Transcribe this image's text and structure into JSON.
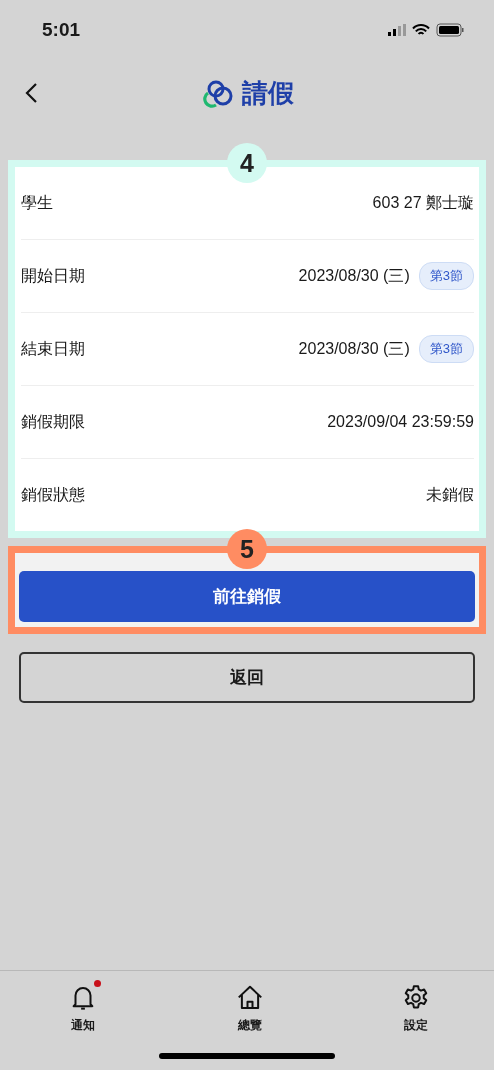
{
  "status_bar": {
    "time": "5:01"
  },
  "header": {
    "title": "請假"
  },
  "details": {
    "callout": "4",
    "rows": [
      {
        "label": "學生",
        "value": "603 27 鄭士璇"
      },
      {
        "label": "開始日期",
        "value": "2023/08/30 (三)",
        "tag": "第3節"
      },
      {
        "label": "結束日期",
        "value": "2023/08/30 (三)",
        "tag": "第3節"
      },
      {
        "label": "銷假期限",
        "value": "2023/09/04 23:59:59"
      },
      {
        "label": "銷假狀態",
        "value": "未銷假"
      }
    ]
  },
  "primary_action": {
    "callout": "5",
    "label": "前往銷假"
  },
  "secondary_action": {
    "label": "返回"
  },
  "tab_bar": [
    {
      "kind": "bell",
      "label": "通知",
      "unread": true
    },
    {
      "kind": "home",
      "label": "總覽",
      "unread": false
    },
    {
      "kind": "gear",
      "label": "設定",
      "unread": false
    }
  ]
}
